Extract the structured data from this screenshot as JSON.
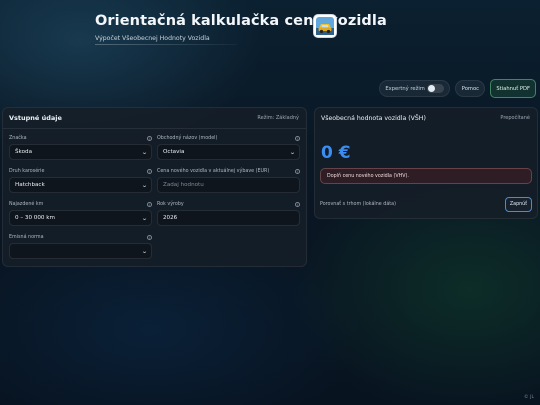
{
  "app": {
    "title": "Orientačná kalkulačka ceny vozidla",
    "subtitle": "Výpočet Všeobecnej Hodnoty Vozidla"
  },
  "toolbar": {
    "expert_label": "Expertný režim",
    "expert_enabled": false,
    "help_label": "Pomoc",
    "pdf_label": "Stiahnuť PDF"
  },
  "inputs_panel": {
    "title": "Vstupné údaje",
    "mode": "Režim: Základný",
    "fields": {
      "brand": {
        "label": "Značka",
        "value": "Škoda"
      },
      "model": {
        "label": "Obchodný názov (model)",
        "value": "Octavia"
      },
      "body": {
        "label": "Druh karosérie",
        "value": "Hatchback"
      },
      "new_price": {
        "label": "Cena nového vozidla v aktuálnej výbave (EUR)",
        "value": "",
        "placeholder": "Zadaj hodnotu"
      },
      "mileage": {
        "label": "Najazdené km",
        "value": "0 – 30 000 km"
      },
      "year": {
        "label": "Rok výroby",
        "value": "2026"
      },
      "emission": {
        "label": "Emisná norma",
        "value": ""
      }
    }
  },
  "result_panel": {
    "title": "Všeobecná hodnota vozidla (VŠH)",
    "recalc_label": "Prepočítané",
    "price": "0 €",
    "alert": "Doplň cenu nového vozidla (VHV).",
    "compare_label": "Porovnať s trhom (lokálne dáta)",
    "reveal_label": "Zapnúť"
  },
  "footer": {
    "text": "© JL"
  },
  "icons": {
    "info": "info-icon",
    "dropdown": "chevron-down-icon",
    "logo": "car-logo-icon"
  },
  "colors": {
    "accent": "#3a8df2",
    "pdf_border": "#6ec88c",
    "alert_border": "#d28c8c"
  }
}
